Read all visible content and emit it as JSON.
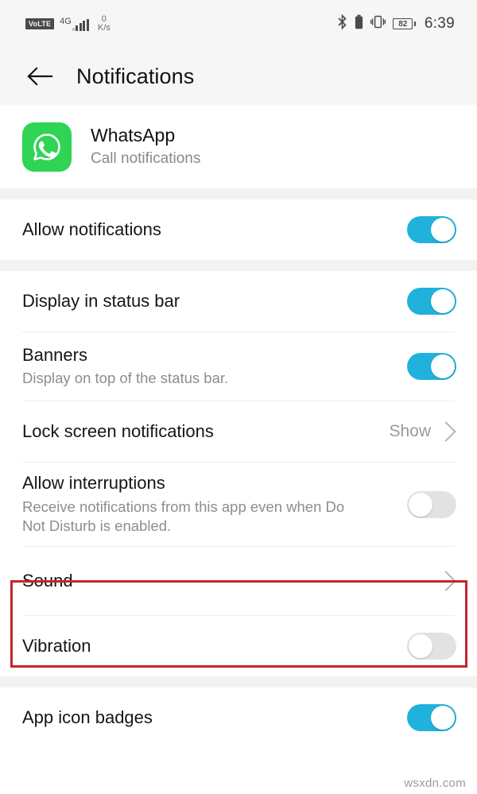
{
  "status_bar": {
    "volte_label": "VoLTE",
    "network_type": "4G",
    "data_speed_value": "0",
    "data_speed_unit": "K/s",
    "bluetooth_icon": "bluetooth-icon",
    "battery_icon": "battery-solid-icon",
    "vibrate_icon": "vibrate-icon",
    "battery_percent": "82",
    "time": "6:39"
  },
  "app_bar": {
    "back_icon": "back-arrow-icon",
    "title": "Notifications"
  },
  "app_header": {
    "icon": "whatsapp-icon",
    "name": "WhatsApp",
    "channel": "Call notifications"
  },
  "settings": [
    {
      "name": "allow-notifications",
      "title": "Allow notifications",
      "subtitle": "",
      "control": "toggle",
      "state": "on"
    },
    {
      "name": "display-in-status-bar",
      "title": "Display in status bar",
      "subtitle": "",
      "control": "toggle",
      "state": "on"
    },
    {
      "name": "banners",
      "title": "Banners",
      "subtitle": "Display on top of the status bar.",
      "control": "toggle",
      "state": "on"
    },
    {
      "name": "lock-screen-notifications",
      "title": "Lock screen notifications",
      "subtitle": "",
      "control": "value-chevron",
      "value": "Show"
    },
    {
      "name": "allow-interruptions",
      "title": "Allow interruptions",
      "subtitle": "Receive notifications from this app even when Do Not Disturb is enabled.",
      "control": "toggle",
      "state": "off"
    },
    {
      "name": "sound",
      "title": "Sound",
      "subtitle": "",
      "control": "chevron",
      "highlighted": "true"
    },
    {
      "name": "vibration",
      "title": "Vibration",
      "subtitle": "",
      "control": "toggle",
      "state": "off"
    },
    {
      "name": "app-icon-badges",
      "title": "App icon badges",
      "subtitle": "",
      "control": "toggle",
      "state": "on"
    }
  ],
  "annotation": {
    "highlight_color": "#c1272d",
    "target": "Sound"
  },
  "watermark": "wsxdn.com",
  "colors": {
    "toggle_on": "#20b2dc",
    "toggle_off": "#e2e2e2",
    "app_icon_green": "#2fd455",
    "section_gap": "#f2f2f2",
    "appbar_bg": "#f6f6f6"
  }
}
